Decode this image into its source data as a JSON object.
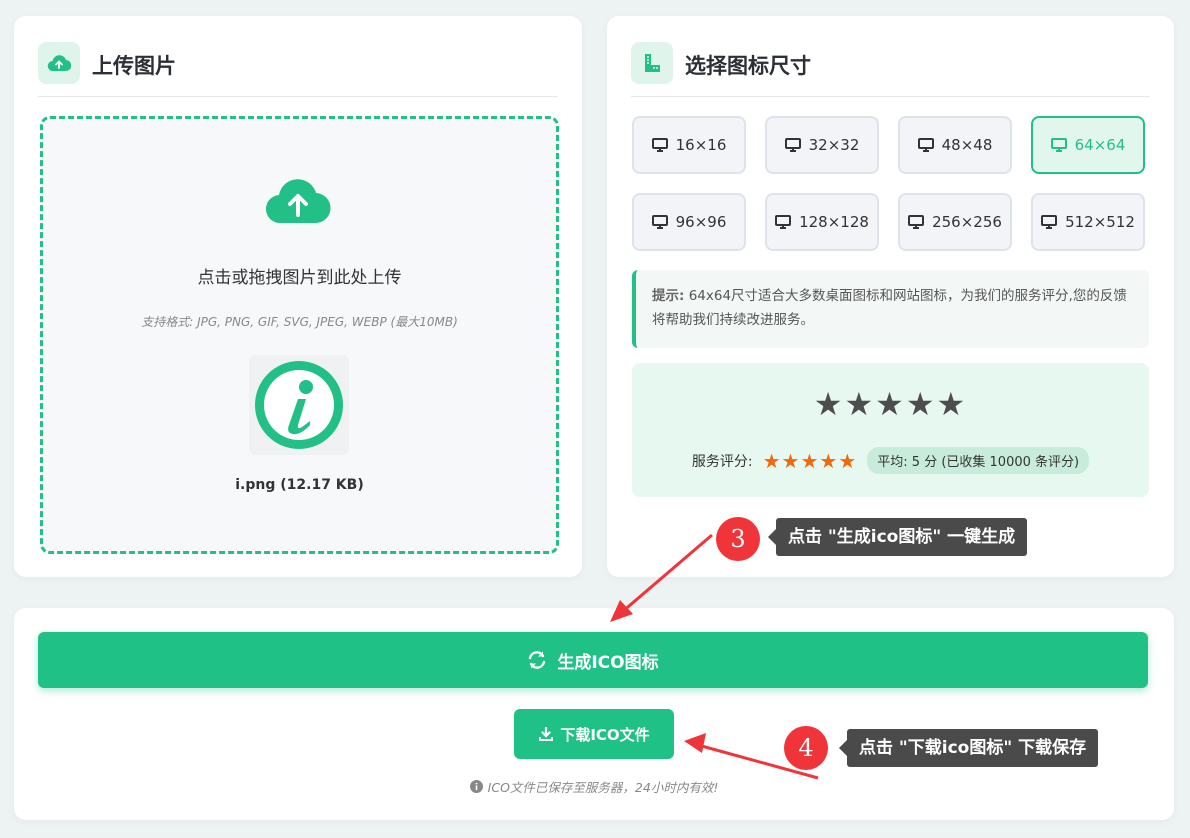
{
  "upload": {
    "title": "上传图片",
    "drop_text": "点击或拖拽图片到此处上传",
    "formats_hint": "支持格式: JPG, PNG, GIF, SVG, JPEG, WEBP (最大10MB)",
    "file_name": "i.png (12.17 KB)"
  },
  "sizes": {
    "title": "选择图标尺寸",
    "options": [
      {
        "label": "16×16",
        "active": false
      },
      {
        "label": "32×32",
        "active": false
      },
      {
        "label": "48×48",
        "active": false
      },
      {
        "label": "64×64",
        "active": true
      },
      {
        "label": "96×96",
        "active": false
      },
      {
        "label": "128×128",
        "active": false
      },
      {
        "label": "256×256",
        "active": false
      },
      {
        "label": "512×512",
        "active": false
      }
    ],
    "tip_label": "提示:",
    "tip_text": " 64x64尺寸适合大多数桌面图标和网站图标，为我们的服务评分,您的反馈将帮助我们持续改进服务。"
  },
  "rating": {
    "big_stars": "★★★★★",
    "label": "服务评分:",
    "small_stars": "★★★★★",
    "score": 5,
    "average_text": "平均: 5 分 (已收集 10000 条评分)"
  },
  "actions": {
    "generate_label": "生成ICO图标",
    "download_label": "下载ICO文件",
    "note": "ICO文件已保存至服务器，24小时内有效!"
  },
  "annotations": {
    "step3_number": "3",
    "step3_text": "点击 \"生成ico图标\" 一键生成",
    "step4_number": "4",
    "step4_text": "点击 \"下载ico图标\" 下载保存"
  },
  "colors": {
    "accent": "#20c187",
    "star_orange": "#f06a0c",
    "callout_red": "#f0353a",
    "callout_dark": "#4a4a4a"
  },
  "icons": [
    "cloud-upload-icon",
    "ruler-icon",
    "monitor-icon",
    "info-logo-icon",
    "refresh-icon",
    "download-icon",
    "info-circle-icon"
  ]
}
